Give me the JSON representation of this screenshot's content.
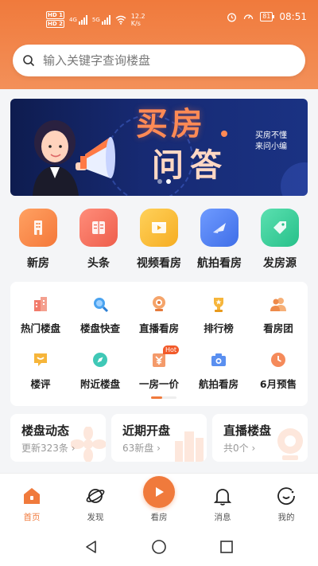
{
  "status_bar": {
    "network_speed": "12.2",
    "network_unit": "K/s",
    "hd1": "HD 1",
    "hd2": "HD 2",
    "signal1": "4G",
    "signal2": "5G",
    "battery": "81",
    "time": "08:51"
  },
  "search": {
    "placeholder": "输入关键字查询楼盘"
  },
  "banner": {
    "title_line1": "买房",
    "title_line2": "问答",
    "subtitle_line1": "买房不懂",
    "subtitle_line2": "来问小编",
    "dot_count": 2,
    "active_dot": 1
  },
  "categories": [
    {
      "label": "新房",
      "icon": "building-icon",
      "color": "#f48a4a"
    },
    {
      "label": "头条",
      "icon": "news-icon",
      "color": "#f06b5a"
    },
    {
      "label": "视频看房",
      "icon": "video-icon",
      "color": "#f7b731"
    },
    {
      "label": "航拍看房",
      "icon": "plane-icon",
      "color": "#4d7ef0"
    },
    {
      "label": "发房源",
      "icon": "tag-icon",
      "color": "#3ccf9a"
    }
  ],
  "grid": [
    {
      "label": "热门楼盘",
      "icon": "hot-building-icon"
    },
    {
      "label": "楼盘快查",
      "icon": "search-icon"
    },
    {
      "label": "直播看房",
      "icon": "camera-icon"
    },
    {
      "label": "排行榜",
      "icon": "trophy-icon"
    },
    {
      "label": "看房团",
      "icon": "group-icon"
    },
    {
      "label": "楼评",
      "icon": "review-icon"
    },
    {
      "label": "附近楼盘",
      "icon": "compass-icon"
    },
    {
      "label": "一房一价",
      "icon": "price-icon",
      "badge": "Hot"
    },
    {
      "label": "航拍看房",
      "icon": "aerial-icon"
    },
    {
      "label": "6月预售",
      "icon": "clock-icon"
    }
  ],
  "cards": [
    {
      "title": "楼盘动态",
      "sub": "更新323条 ›"
    },
    {
      "title": "近期开盘",
      "sub": "63新盘 ›"
    },
    {
      "title": "直播楼盘",
      "sub": "共0个 ›"
    }
  ],
  "tabs": [
    {
      "label": "首页",
      "icon": "home-icon",
      "active": true
    },
    {
      "label": "发现",
      "icon": "planet-icon",
      "active": false
    },
    {
      "label": "看房",
      "icon": "play-icon",
      "active": false
    },
    {
      "label": "消息",
      "icon": "bell-icon",
      "active": false
    },
    {
      "label": "我的",
      "icon": "smile-icon",
      "active": false
    }
  ],
  "colors": {
    "accent": "#f07a3c",
    "banner_bg": "#142463"
  }
}
